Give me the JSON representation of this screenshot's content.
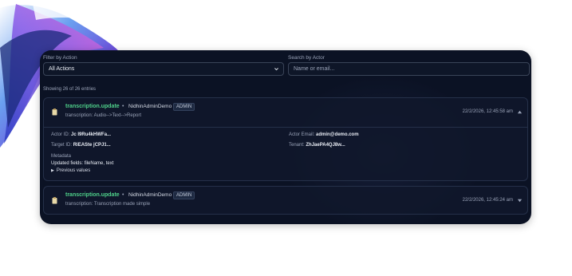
{
  "filters": {
    "action_label": "Filter by Action",
    "action_value": "All Actions",
    "actor_label": "Search by Actor",
    "actor_placeholder": "Name or email..."
  },
  "showing_text": "Showing 26 of 26 entries",
  "entries": [
    {
      "action": "transcription.update",
      "actor": "NidhinAdminDemo",
      "role": "ADMIN",
      "summary": "transcription: Audio-->Text-->Report",
      "timestamp": "22/2/2026, 12:45:58 am",
      "details": {
        "actor_id_label": "Actor ID:",
        "actor_id": "Jc I9Ru4kHWFa...",
        "target_id_label": "Target ID:",
        "target_id": "RiEASte jCPJ1...",
        "actor_email_label": "Actor Email:",
        "actor_email": "admin@demo.com",
        "tenant_label": "Tenant:",
        "tenant": "ZhJaePA4QJ8w...",
        "metadata_label": "Metadata",
        "updated_fields": "Updated fields: fileName, text",
        "previous_values": "Previous values"
      }
    },
    {
      "action": "transcription.update",
      "actor": "NidhinAdminDemo",
      "role": "ADMIN",
      "summary": "transcription: Transcription made simple",
      "timestamp": "22/2/2026, 12:45:24 am"
    }
  ],
  "colors": {
    "panel_bg": "#0b1224",
    "action_green": "#4fd18a",
    "muted_text": "#9aa3b8"
  },
  "icons": {
    "entry_icon": "clipboard-icon",
    "expanded_icon": "triangle-up-icon",
    "collapsed_icon": "triangle-down-icon",
    "select_icon": "chevron-down-icon"
  }
}
